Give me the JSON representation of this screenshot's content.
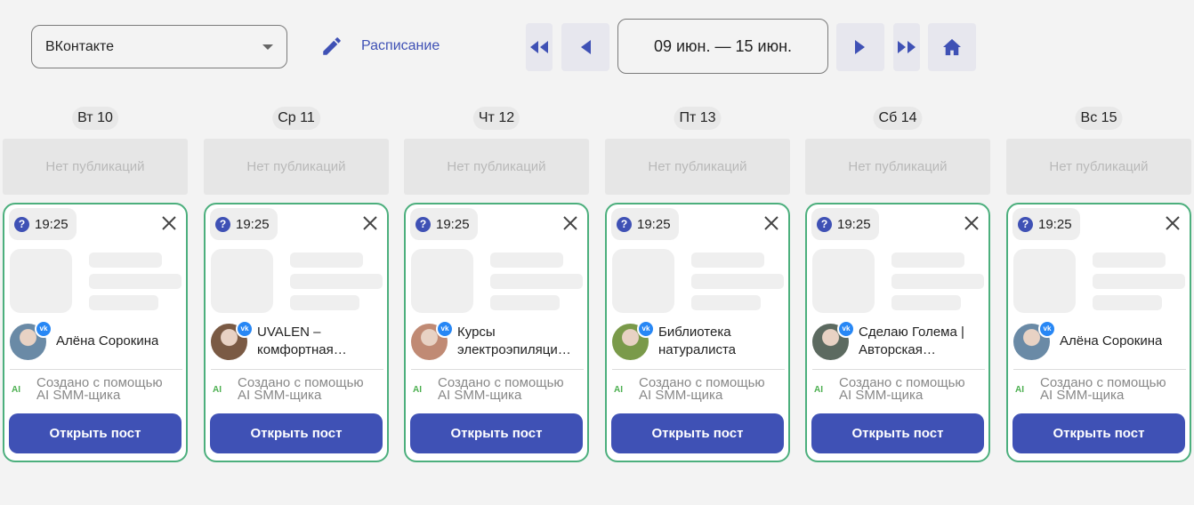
{
  "toolbar": {
    "platform": {
      "value": "ВКонтакте"
    },
    "schedule_label": "Расписание",
    "date_range": "09 июн. — 15 июн."
  },
  "no_posts_label": "Нет публикаций",
  "card": {
    "ai_line1": "Создано с помощью",
    "ai_line2": "AI SMM-щика",
    "ai_badge": "AI",
    "open_button": "Открыть пост",
    "vk_badge": "vk"
  },
  "days": [
    {
      "dow": "Вт",
      "num": "10",
      "time": "19:25",
      "account": "Алёна Сорокина",
      "avatar_color": "#6a8aa6"
    },
    {
      "dow": "Ср",
      "num": "11",
      "time": "19:25",
      "account": "UVALEN – комфортная…",
      "avatar_color": "#7a5a44"
    },
    {
      "dow": "Чт",
      "num": "12",
      "time": "19:25",
      "account": "Курсы электроэпиляци…",
      "avatar_color": "#c08a74"
    },
    {
      "dow": "Пт",
      "num": "13",
      "time": "19:25",
      "account": "Библиотека натуралиста",
      "avatar_color": "#7a9a4a"
    },
    {
      "dow": "Сб",
      "num": "14",
      "time": "19:25",
      "account": "Сделаю Голема | Авторская…",
      "avatar_color": "#5c6a60"
    },
    {
      "dow": "Вс",
      "num": "15",
      "time": "19:25",
      "account": "Алёна Сорокина",
      "avatar_color": "#6a8aa6"
    }
  ],
  "colors": {
    "accent": "#3f51b5",
    "card_border": "#4caf7d",
    "vk": "#2787f5",
    "ai_green": "#4caf50"
  },
  "icons": {
    "pencil": "pencil-icon",
    "first": "double-chevron-left-icon",
    "prev": "chevron-left-icon",
    "next": "chevron-right-icon",
    "last": "double-chevron-right-icon",
    "today": "home-icon",
    "dropdown": "caret-down-icon",
    "close": "close-icon",
    "status": "question-icon"
  }
}
